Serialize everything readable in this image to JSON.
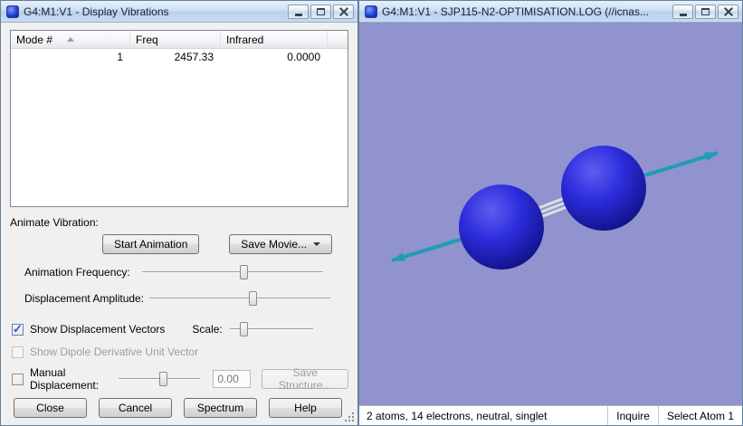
{
  "left_window": {
    "title": "G4:M1:V1 - Display Vibrations",
    "table": {
      "columns": [
        "Mode #",
        "Freq",
        "Infrared"
      ],
      "rows": [
        {
          "mode": "1",
          "freq": "2457.33",
          "infrared": "0.0000"
        }
      ]
    },
    "animate_section_label": "Animate Vibration:",
    "start_animation_button": "Start Animation",
    "save_movie_button": "Save Movie...",
    "animation_frequency_label": "Animation Frequency:",
    "displacement_amplitude_label": "Displacement Amplitude:",
    "show_displacement_vectors_label": "Show Displacement Vectors",
    "scale_label": "Scale:",
    "show_dipole_label": "Show Dipole Derivative Unit Vector",
    "manual_displacement_label": "Manual Displacement:",
    "manual_displacement_value": "0.00",
    "save_structure_button": "Save Structure...",
    "close_button": "Close",
    "cancel_button": "Cancel",
    "spectrum_button": "Spectrum",
    "help_button": "Help",
    "states": {
      "show_displacement_vectors": true,
      "show_dipole_derivative": false,
      "manual_displacement": false
    }
  },
  "right_window": {
    "title": "G4:M1:V1 - SJP115-N2-OPTIMISATION.LOG (//icnas...",
    "status_bar": {
      "left_text": "2 atoms, 14 electrons, neutral, singlet",
      "inquire_label": "Inquire",
      "select_label": "Select Atom 1"
    },
    "colors": {
      "viewport_bg": "#9193ce",
      "atom_blue": "#2c2cdc",
      "vector_teal": "#1e9cb8"
    }
  }
}
